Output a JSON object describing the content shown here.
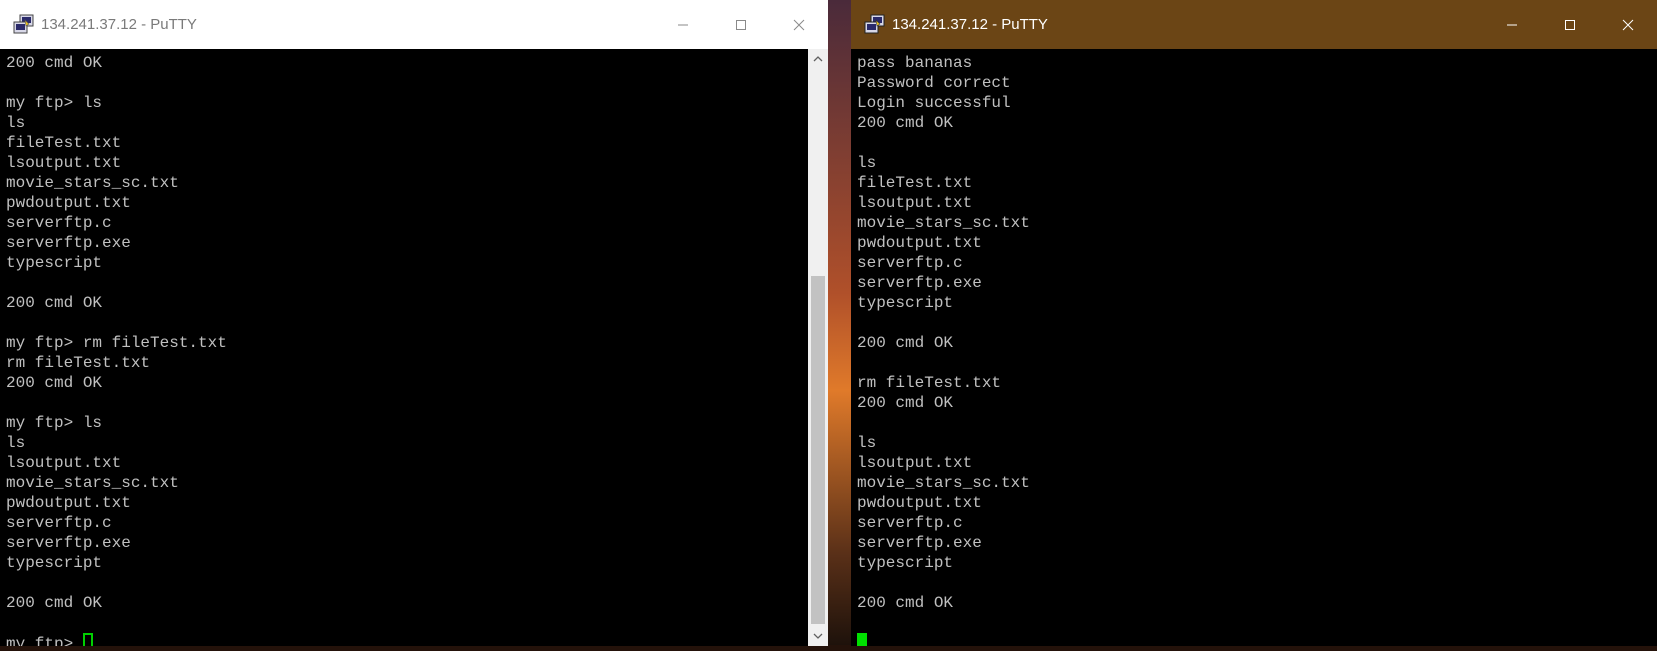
{
  "left_window": {
    "title": "134.241.37.12 - PuTTY",
    "lines": [
      "200 cmd OK",
      "",
      "my ftp> ls",
      "ls",
      "fileTest.txt",
      "lsoutput.txt",
      "movie_stars_sc.txt",
      "pwdoutput.txt",
      "serverftp.c",
      "serverftp.exe",
      "typescript",
      "",
      "200 cmd OK",
      "",
      "my ftp> rm fileTest.txt",
      "rm fileTest.txt",
      "200 cmd OK",
      "",
      "my ftp> ls",
      "ls",
      "lsoutput.txt",
      "movie_stars_sc.txt",
      "pwdoutput.txt",
      "serverftp.c",
      "serverftp.exe",
      "typescript",
      "",
      "200 cmd OK",
      ""
    ],
    "prompt": "my ftp> ",
    "cursor_style": "hollow"
  },
  "right_window": {
    "title": "134.241.37.12 - PuTTY",
    "lines": [
      "pass bananas",
      "Password correct",
      "Login successful",
      "200 cmd OK",
      "",
      "ls",
      "fileTest.txt",
      "lsoutput.txt",
      "movie_stars_sc.txt",
      "pwdoutput.txt",
      "serverftp.c",
      "serverftp.exe",
      "typescript",
      "",
      "200 cmd OK",
      "",
      "rm fileTest.txt",
      "200 cmd OK",
      "",
      "ls",
      "lsoutput.txt",
      "movie_stars_sc.txt",
      "pwdoutput.txt",
      "serverftp.c",
      "serverftp.exe",
      "typescript",
      "",
      "200 cmd OK",
      ""
    ],
    "prompt": "",
    "cursor_style": "solid"
  },
  "icons": {
    "app": "putty-icon",
    "minimize": "minimize-icon",
    "maximize": "maximize-icon",
    "close": "close-icon",
    "scroll_up": "scroll-up-arrow-icon",
    "scroll_down": "scroll-down-arrow-icon"
  },
  "colors": {
    "terminal_bg": "#000000",
    "terminal_fg": "#c0c0c0",
    "cursor": "#00e000",
    "left_titlebar": "#ffffff",
    "right_titlebar": "#6b4515"
  }
}
